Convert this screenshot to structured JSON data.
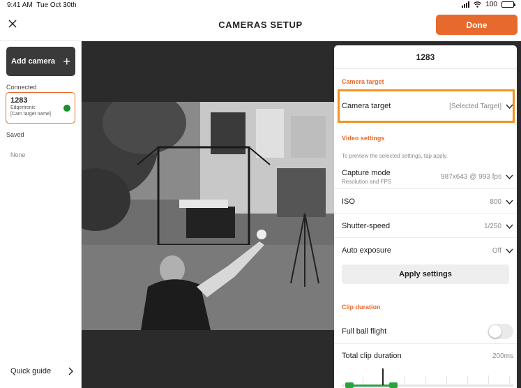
{
  "status_bar": {
    "time": "9:41 AM",
    "date": "Tue Oct 30th",
    "battery": "100"
  },
  "header": {
    "title": "CAMERAS SETUP",
    "done_label": "Done"
  },
  "sidebar": {
    "add_camera_label": "Add camera",
    "connected_label": "Connected",
    "camera": {
      "id": "1283",
      "model": "Edgertronic",
      "target": "[Cam target name]",
      "status_color": "#1a8f2a"
    },
    "saved_label": "Saved",
    "saved_none": "None",
    "quick_guide_label": "Quick guide"
  },
  "panel": {
    "title": "1283",
    "camera_target_section": "Camera target",
    "camera_target_label": "Camera target",
    "camera_target_value": "[Selected Target]",
    "video_settings_section": "Video settings",
    "video_settings_hint": "To preview the selected settings, tap apply.",
    "capture_mode_label": "Capture mode",
    "capture_mode_sub": "Resolution and FPS",
    "capture_mode_value": "987x643 @ 993 fps",
    "iso_label": "ISO",
    "iso_value": "800",
    "shutter_label": "Shutter-speed",
    "shutter_value": "1/250",
    "auto_exposure_label": "Auto exposure",
    "auto_exposure_value": "Off",
    "apply_label": "Apply settings",
    "clip_duration_section": "Clip duration",
    "full_ball_flight_label": "Full ball flight",
    "full_ball_flight_on": false,
    "total_clip_label": "Total clip duration",
    "total_clip_value": "200ms"
  },
  "colors": {
    "accent": "#e8692e",
    "highlight": "#f2931f",
    "status_green": "#1a8f2a"
  },
  "icons": [
    "close-icon",
    "plus-icon",
    "chevron-right-icon",
    "chevron-down-icon",
    "signal-icon",
    "wifi-icon",
    "battery-icon"
  ]
}
